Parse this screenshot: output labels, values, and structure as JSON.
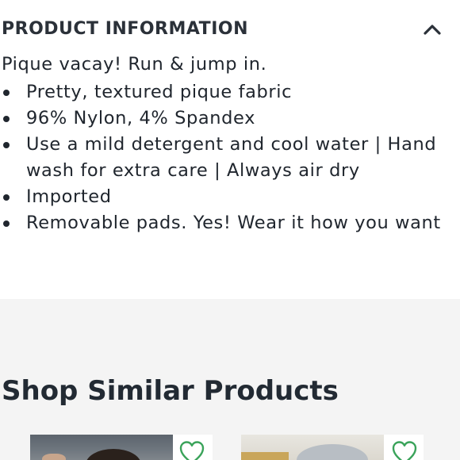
{
  "product_info": {
    "title": "PRODUCT INFORMATION",
    "toggle_icon": "chevron-up-icon",
    "intro": "Pique vacay! Run & jump in.",
    "bullets": [
      "Pretty, textured pique fabric",
      "96% Nylon, 4% Spandex",
      "Use a mild detergent and cool water | Hand wash for extra care | Always air dry",
      "Imported",
      "Removable pads. Yes! Wear it how you want"
    ]
  },
  "similar": {
    "title": "Shop Similar Products",
    "products": [
      {
        "image": "model-photo",
        "wishlist_icon": "heart-outline-icon"
      },
      {
        "image": "hat-photo",
        "wishlist_icon": "heart-outline-icon"
      }
    ]
  },
  "colors": {
    "text": "#20262e",
    "heading": "#2b3139",
    "wishlist_accent": "#3aa35a",
    "section_bg": "#f4f4f4"
  }
}
